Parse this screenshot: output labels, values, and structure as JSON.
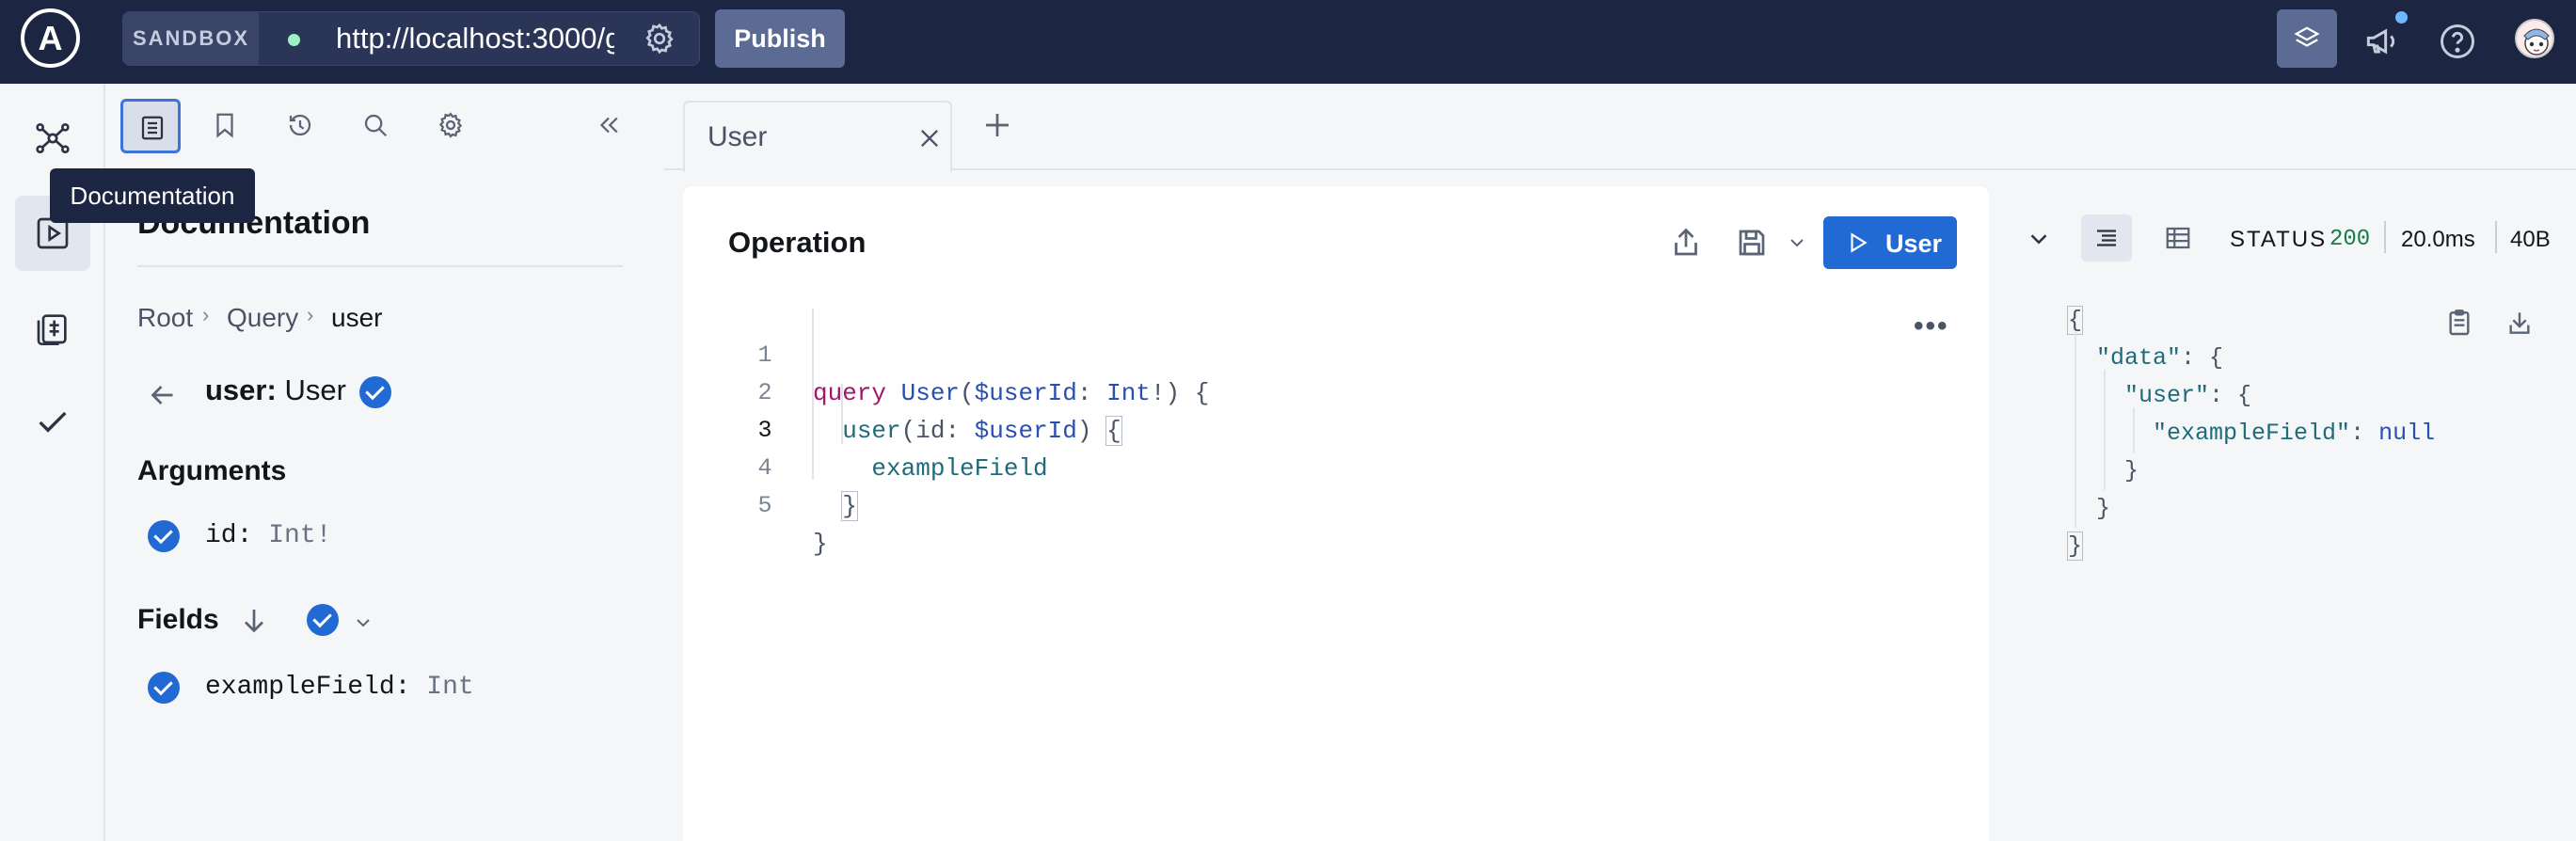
{
  "topbar": {
    "logo_text": "A",
    "sandbox_label": "SANDBOX",
    "url": "http://localhost:3000/g",
    "publish_label": "Publish",
    "icons": [
      "graph-layers-icon",
      "megaphone-icon",
      "help-icon",
      "avatar"
    ]
  },
  "rail": {
    "items": [
      {
        "name": "schema",
        "icon": "graph-icon"
      },
      {
        "name": "explorer",
        "icon": "play-square-icon",
        "selected": true
      },
      {
        "name": "operation-collections",
        "icon": "collections-icon"
      },
      {
        "name": "checks",
        "icon": "checkmark-icon"
      }
    ]
  },
  "docs": {
    "tooltip": "Documentation",
    "title": "Documentation",
    "breadcrumb": [
      "Root",
      "Query",
      "user"
    ],
    "field_name": "user",
    "field_colon": ":",
    "field_type": "User",
    "arguments_title": "Arguments",
    "args": [
      {
        "name": "id",
        "colon": ":",
        "type": "Int!"
      }
    ],
    "fields_title": "Fields",
    "fields": [
      {
        "name": "exampleField",
        "colon": ":",
        "type": "Int"
      }
    ]
  },
  "editor": {
    "tab_label": "User",
    "operation_title": "Operation",
    "run_label": "User",
    "line_numbers": [
      "1",
      "2",
      "3",
      "4",
      "5"
    ]
  },
  "response": {
    "status_label": "STATUS",
    "status_code": "200",
    "time": "20.0ms",
    "size": "40B"
  },
  "colors": {
    "topbar": "#1c2541",
    "accent": "#2169d3",
    "publish": "#5c6b94",
    "status_ok": "#1a7a4a"
  }
}
